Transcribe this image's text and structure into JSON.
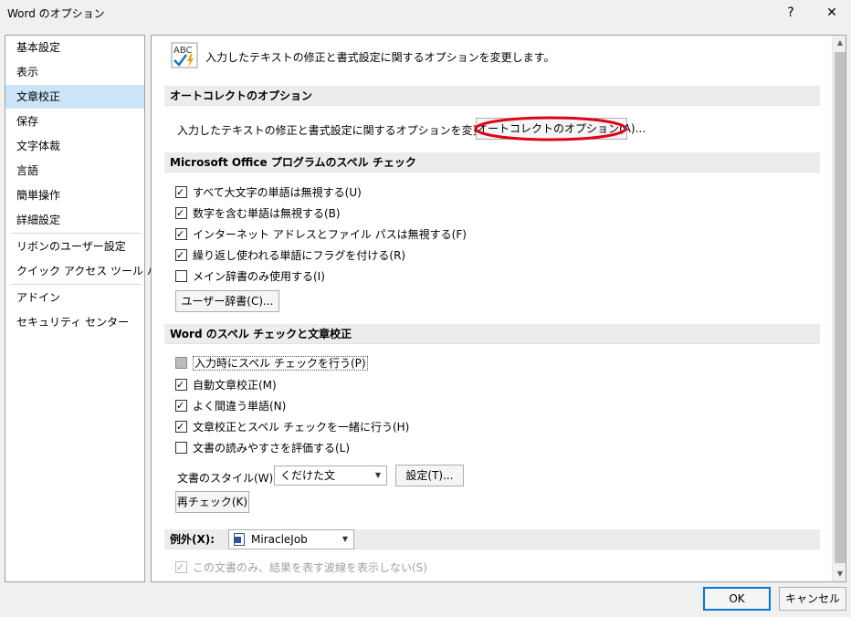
{
  "window": {
    "title": "Word のオプション",
    "help_label": "?",
    "close_label": "✕"
  },
  "sidebar": {
    "items": [
      {
        "label": "基本設定"
      },
      {
        "label": "表示"
      },
      {
        "label": "文章校正",
        "selected": true
      },
      {
        "label": "保存"
      },
      {
        "label": "文字体裁"
      },
      {
        "label": "言語"
      },
      {
        "label": "簡単操作"
      },
      {
        "label": "詳細設定"
      },
      {
        "label": "リボンのユーザー設定"
      },
      {
        "label": "クイック アクセス ツール バー"
      },
      {
        "label": "アドイン"
      },
      {
        "label": "セキュリティ センター"
      }
    ]
  },
  "main": {
    "intro_icon_text": "ABC",
    "intro_text": "入力したテキストの修正と書式設定に関するオプションを変更します。",
    "autocorrect": {
      "header": "オートコレクトのオプション",
      "description": "入力したテキストの修正と書式設定に関するオプションを変更します。",
      "button_label": "オートコレクトのオプション(A)...",
      "highlight_color": "#e0001a"
    },
    "office_spell": {
      "header": "Microsoft Office プログラムのスペル チェック",
      "options": [
        {
          "label": "すべて大文字の単語は無視する(U)",
          "checked": true
        },
        {
          "label": "数字を含む単語は無視する(B)",
          "checked": true
        },
        {
          "label": "インターネット アドレスとファイル パスは無視する(F)",
          "checked": true
        },
        {
          "label": "繰り返し使われる単語にフラグを付ける(R)",
          "checked": true
        },
        {
          "label": "メイン辞書のみ使用する(I)",
          "checked": false
        }
      ],
      "custom_dict_button": "ユーザー辞書(C)..."
    },
    "word_spell": {
      "header": "Word のスペル チェックと文章校正",
      "options": [
        {
          "label": "入力時にスペル チェックを行う(P)",
          "checked": false,
          "state": "gray"
        },
        {
          "label": "自動文章校正(M)",
          "checked": true
        },
        {
          "label": "よく間違う単語(N)",
          "checked": true
        },
        {
          "label": "文章校正とスペル チェックを一緒に行う(H)",
          "checked": true
        },
        {
          "label": "文書の読みやすさを評価する(L)",
          "checked": false
        }
      ],
      "style_label": "文書のスタイル(W):",
      "style_value": "くだけた文",
      "settings_button": "設定(T)...",
      "recheck_button": "再チェック(K)"
    },
    "exceptions": {
      "header_label": "例外(X):",
      "document_name": "MiracleJob",
      "option_label": "この文書のみ、結果を表す波線を表示しない(S)",
      "option_checked": true
    }
  },
  "footer": {
    "ok_label": "OK",
    "cancel_label": "キャンセル"
  },
  "colors": {
    "selection": "#cce4f7",
    "accent": "#0078d7",
    "icon_check": "#1e73be",
    "icon_bolt": "#f0a30a"
  }
}
